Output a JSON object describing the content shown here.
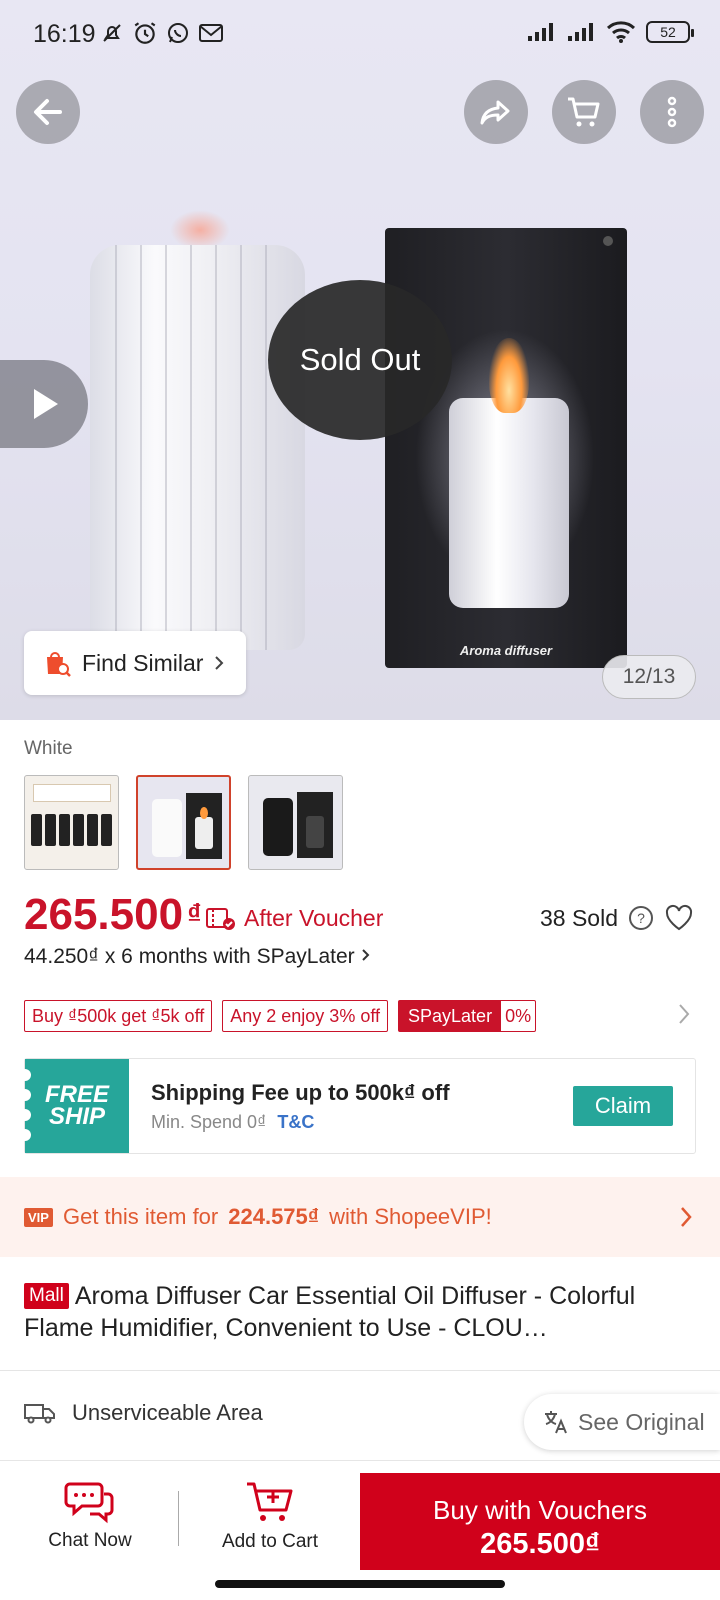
{
  "status_bar": {
    "time": "16:19",
    "battery": "52",
    "left_icons": [
      "mute-icon",
      "alarm-icon",
      "whatsapp-icon",
      "gmail-icon"
    ],
    "right_icons": [
      "signal-icon",
      "signal-icon",
      "wifi-icon",
      "battery-icon"
    ]
  },
  "hero": {
    "sold_out": "Sold Out",
    "find_similar": "Find Similar",
    "image_counter": "12/13",
    "box_label": "Aroma diffuser"
  },
  "variant": {
    "name": "White",
    "selected_index": 1
  },
  "price": {
    "amount": "265.500",
    "currency": "₫",
    "after_voucher": "After Voucher",
    "sold": "38 Sold",
    "installment": "44.250₫ x 6 months with SPayLater"
  },
  "promo_tags": {
    "tag1": "Buy ₫500k get ₫5k off",
    "tag2": "Any 2 enjoy 3% off",
    "spaylater": "SPayLater",
    "spaylater_rate": "0%"
  },
  "freeship": {
    "badge_line1": "FREE",
    "badge_line2": "SHIP",
    "title": "Shipping Fee up to 500k₫ off",
    "subtitle": "Min. Spend 0₫",
    "tc": "T&C",
    "claim": "Claim"
  },
  "vip": {
    "badge": "VIP",
    "text_before": "Get this item for",
    "vip_price": "224.575₫",
    "text_after": "with ShopeeVIP!"
  },
  "product": {
    "mall_badge": "Mall",
    "title": "Aroma Diffuser Car Essential Oil Diffuser - Colorful Flame Humidifier, Convenient to Use - CLOU…"
  },
  "shipping": {
    "label": "Unserviceable Area",
    "see_original": "See Original"
  },
  "bottom_bar": {
    "chat": "Chat Now",
    "cart": "Add to Cart",
    "buy_label": "Buy with Vouchers",
    "buy_price": "265.500₫"
  },
  "colors": {
    "primary_red": "#c9132a",
    "buy_red": "#d0011b",
    "freeship_teal": "#26a69a",
    "vip_orange": "#e05a33"
  }
}
